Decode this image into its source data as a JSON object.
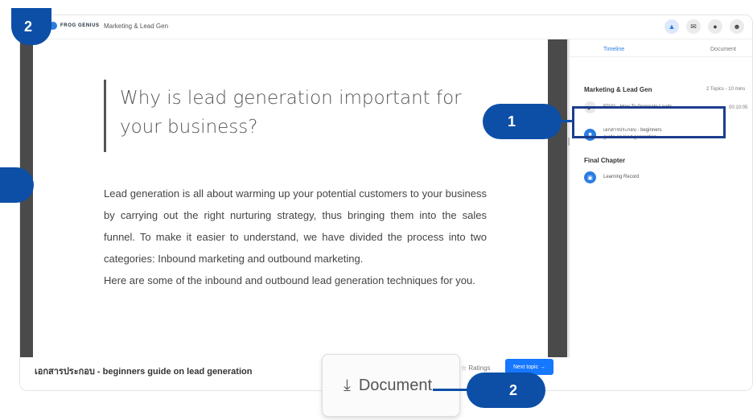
{
  "callouts": {
    "top_left": "2",
    "highlight": "1",
    "bottom": "2"
  },
  "header": {
    "logo_text": "FROG GENIUS",
    "title": "Marketing & Lead Gen",
    "icons": [
      "chart-icon",
      "chat-icon",
      "globe-icon",
      "user-icon"
    ]
  },
  "content": {
    "heading": "Why is lead generation important for your business?",
    "paragraph1": "Lead generation is all about warming up your potential customers to your business by carrying out the right nurturing strategy, thus bringing them into the sales funnel. To make it easier to understand, we have divided the process into two categories: Inbound marketing and outbound marketing.",
    "paragraph2": "Here are some of the inbound and outbound lead generation techniques for you."
  },
  "footer": {
    "doc_title": "เอกสารประกอบ - beginners guide on lead generation",
    "ratings_label": "Ratings",
    "next_label": "Next topic →"
  },
  "sidebar": {
    "tabs": [
      "Timeline",
      "Document"
    ],
    "section1": {
      "title": "Marketing & Lead Gen",
      "meta": "2 Topics - 10 mins",
      "items": [
        {
          "label": "EP.01 - How To Generate Leads",
          "time": "00:10:05"
        },
        {
          "label_line1": "เอกสารประกอบ - beginners",
          "label_line2": "guide on lead generation"
        }
      ]
    },
    "section2": {
      "title": "Final Chapter",
      "items": [
        {
          "label": "Learning Record"
        }
      ]
    }
  },
  "popup": {
    "label": "Document"
  },
  "colors": {
    "accent": "#1677ff",
    "callout": "#0d4fa7",
    "highlight_border": "#1c3d8e"
  }
}
